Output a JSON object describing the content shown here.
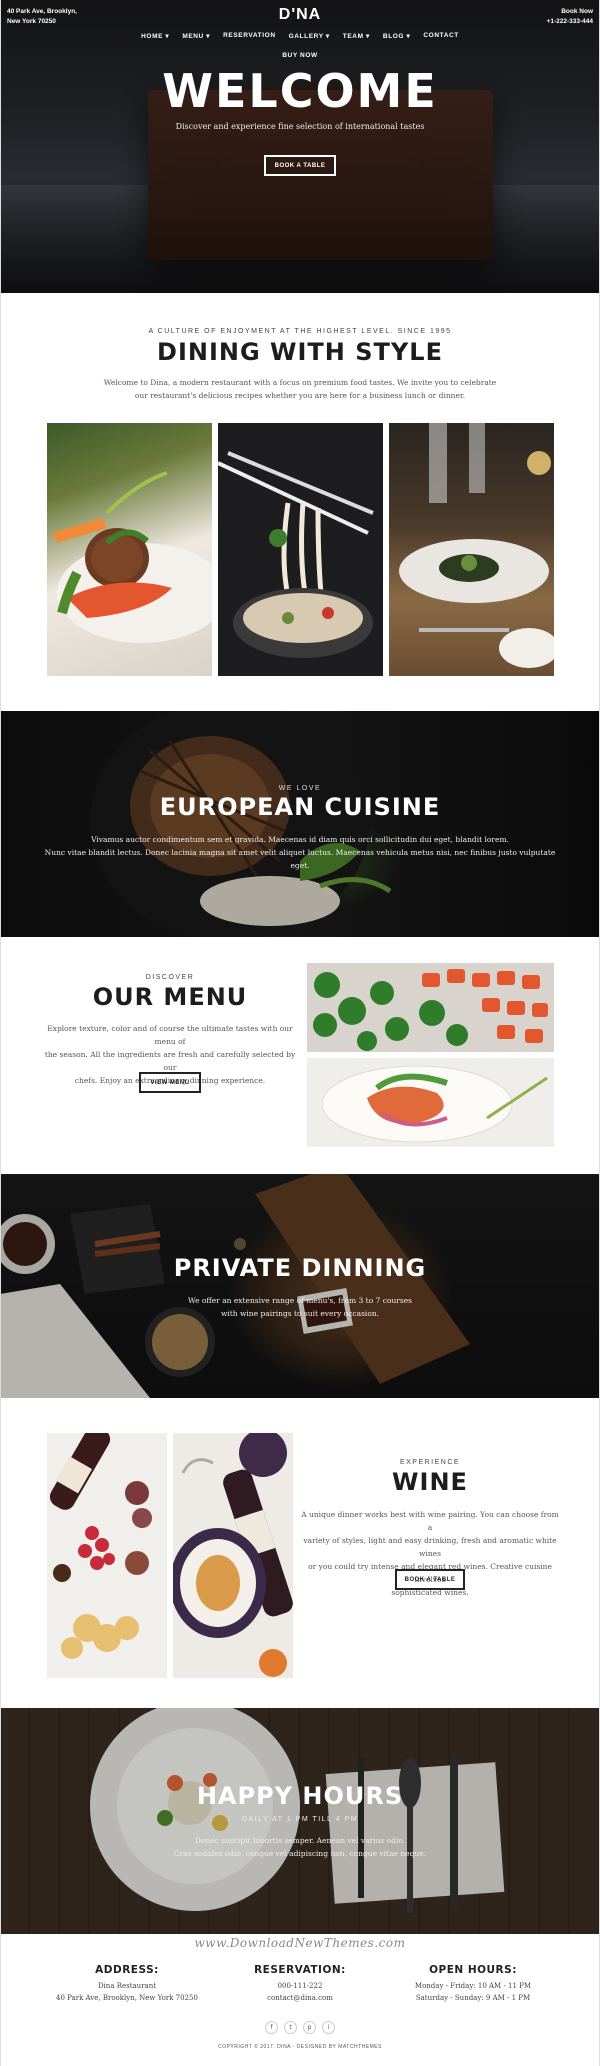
{
  "header": {
    "address_line1": "40 Park Ave, Brooklyn,",
    "address_line2": "New York 70250",
    "logo": "D'NA",
    "book_label": "Book Now",
    "phone": "+1-222-333-444",
    "nav": [
      "HOME",
      "MENU",
      "RESERVATION",
      "GALLERY",
      "TEAM",
      "BLOG",
      "CONTACT"
    ],
    "buy_now": "BUY NOW"
  },
  "hero": {
    "title": "WELCOME",
    "subtitle": "Discover and experience fine selection of international tastes",
    "button": "BOOK A TABLE"
  },
  "dining": {
    "kicker": "A CULTURE OF ENJOYMENT AT THE HIGHEST LEVEL. SINCE 1995",
    "title": "DINING WITH STYLE",
    "text_line1": "Welcome to Dina, a modern restaurant with a focus on premium food tastes. We invite you to celebrate",
    "text_line2": "our restaurant's delicious recipes whether you are here for a business lunch or dinner."
  },
  "european": {
    "kicker": "WE LOVE",
    "title": "EUROPEAN CUISINE",
    "text_line1": "Vivamus auctor condimentum sem et gravida. Maecenas id diam quis orci sollicitudin dui eget, blandit lorem.",
    "text_line2": "Nunc vitae blandit lectus. Donec lacinia magna sit amet velit aliquet luctus. Maecenas vehicula metus nisi, nec finibus justo vulputate eget."
  },
  "menu": {
    "kicker": "DISCOVER",
    "title": "OUR MENU",
    "text_line1": "Explore texture, color and of course the ultimate tastes with our menu of",
    "text_line2": "the season. All the ingredients are fresh and carefully selected by our",
    "text_line3": "chefs. Enjoy an extraordinary dinning experience.",
    "button": "VIEW MENU"
  },
  "private": {
    "title": "PRIVATE DINNING",
    "text_line1": "We offer an extensive range of menu's, from 3 to 7 courses",
    "text_line2": "with wine pairings to suit every occasion."
  },
  "wine": {
    "kicker": "EXPERIENCE",
    "title": "WINE",
    "text_line1": "A unique dinner works best with wine pairing. You can choose from a",
    "text_line2": "variety of styles, light and easy drinking, fresh and aromatic white wines",
    "text_line3": "or you could try intense and elegant red wines. Creative cuisine involves",
    "text_line4": "sophisticated wines.",
    "button": "BOOK A TABLE"
  },
  "happy": {
    "title": "HAPPY HOURS",
    "subtitle": "DAILY AT 1 PM TILL 4 PM",
    "text_line1": "Donec suscipit lobortis semper. Aenean vel varius odio.",
    "text_line2": "Cras sodales odio, congue vel adipiscing non, congue vitae neque."
  },
  "footer": {
    "watermark": "www.DownloadNewThemes.com",
    "address_title": "ADDRESS:",
    "address_line1": "Dina Restaurant",
    "address_line2": "40 Park Ave, Brooklyn, New York 70250",
    "reservation_title": "RESERVATION:",
    "reservation_phone": "000-111-222",
    "reservation_email": "contact@dina.com",
    "hours_title": "OPEN HOURS:",
    "hours_line1": "Monday - Friday: 10 AM - 11 PM",
    "hours_line2": "Saturday - Sunday: 9 AM - 1 PM",
    "socials": [
      "f",
      "t",
      "p",
      "i"
    ],
    "copyright": "COPYRIGHT © 2017. DINA - DESIGNED BY MATCHTHEMES"
  }
}
